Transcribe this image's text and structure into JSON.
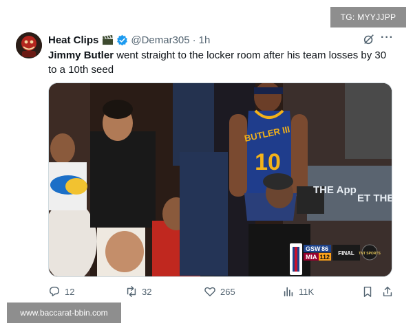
{
  "watermarks": {
    "top": "TG: MYYJJPP",
    "bottom": "www.baccarat-bbin.com"
  },
  "tweet": {
    "display_name": "Heat Clips",
    "name_emoji": "clapperboard-icon",
    "handle": "@Demar305",
    "separator": "·",
    "time": "1h",
    "text_bold": "Jimmy Butler",
    "text_rest": " went straight to the locker room after his team losses by 30 to a 10th seed"
  },
  "media": {
    "jersey_name": "BUTLER III",
    "jersey_number": "10",
    "signage_1": "THE App",
    "signage_2": "ET THE S",
    "scorebug": {
      "team_1": "GSW",
      "score_1": "86",
      "team_2": "MIA",
      "score_2": "112",
      "status": "FINAL",
      "network": "TNT SPORTS"
    }
  },
  "actions": {
    "replies": "12",
    "reposts": "32",
    "likes": "265",
    "views": "11K"
  },
  "colors": {
    "verified": "#1d9bf0",
    "text": "#0f1419",
    "muted": "#536471",
    "watermark_bg": "#8e8e8e"
  }
}
